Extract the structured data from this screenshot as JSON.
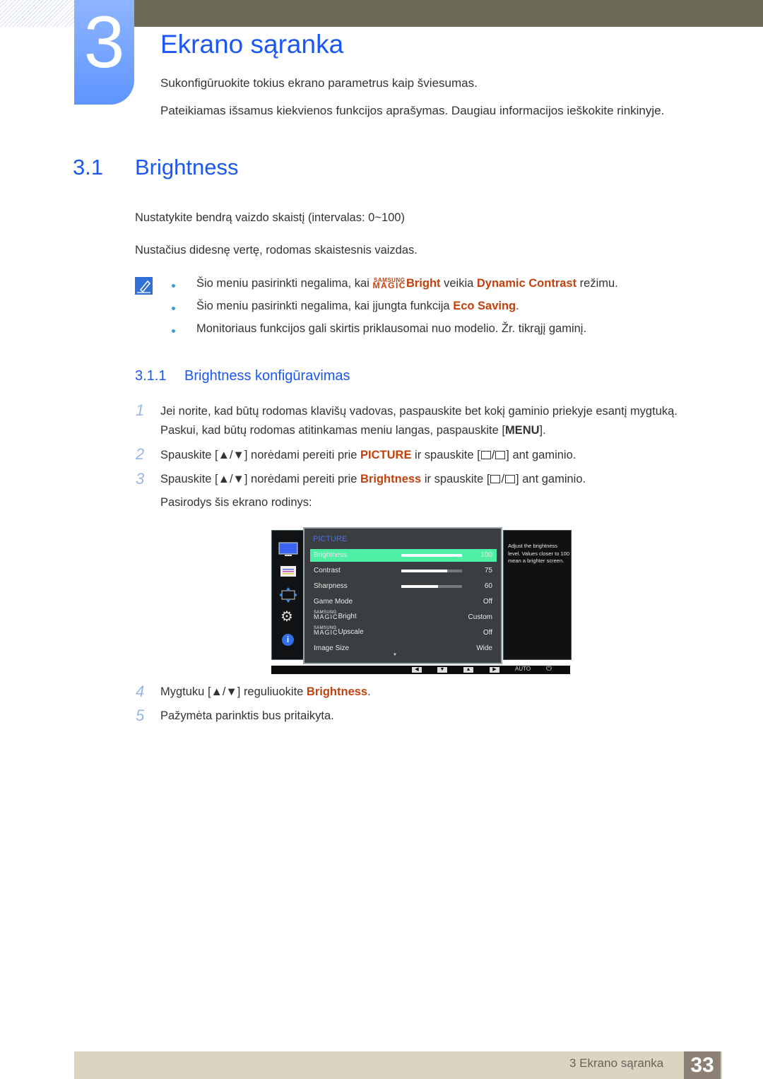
{
  "chapter": {
    "number": "3",
    "title": "Ekrano sąranka",
    "intro": [
      "Sukonfigūruokite tokius ekrano parametrus kaip šviesumas.",
      "Pateikiamas išsamus kiekvienos funkcijos aprašymas. Daugiau informacijos ieškokite rinkinyje."
    ]
  },
  "section": {
    "number": "3.1",
    "title": "Brightness",
    "paragraphs": [
      "Nustatykite bendrą vaizdo skaistį (intervalas: 0~100)",
      "Nustačius didesnę vertę, rodomas skaistesnis vaizdas."
    ]
  },
  "notes": {
    "icon": "note-pencil-icon",
    "items": [
      {
        "pre": "Šio meniu pasirinkti negalima, kai ",
        "magic_top": "SAMSUNG",
        "magic_bottom": "MAGIC",
        "hl1": "Bright",
        "mid": " veikia ",
        "hl2": "Dynamic Contrast",
        "post": " režimu."
      },
      {
        "pre": "Šio meniu pasirinkti negalima, kai įjungta funkcija ",
        "hl1": "Eco Saving",
        "post": "."
      },
      {
        "pre": "Monitoriaus funkcijos gali skirtis priklausomai nuo modelio. Žr. tikrąjį gaminį."
      }
    ]
  },
  "subsection": {
    "number": "3.1.1",
    "title": "Brightness konfigūravimas"
  },
  "steps": [
    {
      "num": "1",
      "line1": "Jei norite, kad būtų rodomas klavišų vadovas, paspauskite bet kokį gaminio priekyje esantį mygtuką.",
      "line2_pre": "Paskui, kad būtų rodomas atitinkamas meniu langas, paspauskite [",
      "key": "MENU",
      "line2_post": "]."
    },
    {
      "num": "2",
      "pre": "Spauskite [▲/▼] norėdami pereiti prie ",
      "hl": "PICTURE",
      "mid": " ir spauskite [",
      "post": "] ant gaminio."
    },
    {
      "num": "3",
      "pre": "Spauskite [▲/▼] norėdami pereiti prie ",
      "hl": "Brightness",
      "mid": " ir spauskite [",
      "post": "] ant gaminio.",
      "line2": "Pasirodys šis ekrano rodinys:"
    },
    {
      "num": "4",
      "pre": "Mygtuku [▲/▼] reguliuokite ",
      "hl": "Brightness",
      "post": "."
    },
    {
      "num": "5",
      "text": "Pažymėta parinktis bus pritaikyta."
    }
  ],
  "osd": {
    "menu_title": "PICTURE",
    "side_icons": [
      "monitor-icon",
      "menu-list-icon",
      "size-position-icon",
      "gear-icon",
      "info-icon"
    ],
    "rows": [
      {
        "label": "Brightness",
        "value": "100",
        "level": 100,
        "selected": true
      },
      {
        "label": "Contrast",
        "value": "75",
        "level": 75
      },
      {
        "label": "Sharpness",
        "value": "60",
        "level": 60
      },
      {
        "label": "Game Mode",
        "value": "Off"
      },
      {
        "magic_top": "SAMSUNG",
        "magic_bottom": "MAGIC",
        "label": "Bright",
        "value": "Custom"
      },
      {
        "magic_top": "SAMSUNG",
        "magic_bottom": "MAGIC",
        "label": "Upscale",
        "value": "Off"
      },
      {
        "label": "Image Size",
        "value": "Wide"
      }
    ],
    "help": "Adjust the brightness level. Values closer to 100 mean a brighter screen.",
    "bottom_buttons": [
      "◀",
      "▼",
      "▲",
      "▶"
    ],
    "auto_label": "AUTO",
    "power_symbol": "⏻",
    "scroll_arrow": "▼"
  },
  "footer": {
    "text": "3 Ekrano sąranka",
    "page": "33"
  },
  "colors": {
    "heading_blue": "#1a57f5",
    "highlight_orange": "#c2410c",
    "osd_selected": "#4df0a4",
    "footer_bg": "#dbd4c0",
    "page_box": "#8c7f73"
  }
}
